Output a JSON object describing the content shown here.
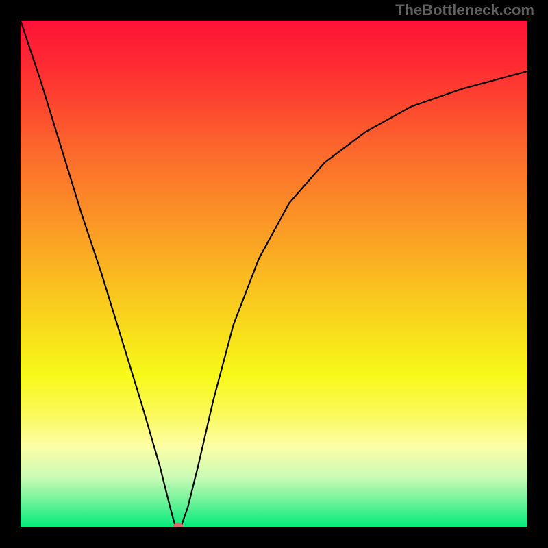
{
  "watermark": "TheBottleneck.com",
  "chart_data": {
    "type": "line",
    "title": "",
    "xlabel": "",
    "ylabel": "",
    "xlim": [
      0,
      1
    ],
    "ylim": [
      0,
      1
    ],
    "legend": null,
    "background_gradient": {
      "stops": [
        {
          "offset": 0.0,
          "color": "#fe1237"
        },
        {
          "offset": 0.1,
          "color": "#fe2f32"
        },
        {
          "offset": 0.25,
          "color": "#fc662c"
        },
        {
          "offset": 0.4,
          "color": "#fb9726"
        },
        {
          "offset": 0.55,
          "color": "#f9c91e"
        },
        {
          "offset": 0.7,
          "color": "#f7f918"
        },
        {
          "offset": 0.78,
          "color": "#faf95e"
        },
        {
          "offset": 0.84,
          "color": "#fdfea6"
        },
        {
          "offset": 0.9,
          "color": "#cbfbb6"
        },
        {
          "offset": 0.94,
          "color": "#80f49e"
        },
        {
          "offset": 1.0,
          "color": "#00ec7b"
        }
      ]
    },
    "series": [
      {
        "name": "curve",
        "color": "#000000",
        "stroke_width": 2.2,
        "x": [
          0.0,
          0.04,
          0.08,
          0.12,
          0.16,
          0.2,
          0.24,
          0.275,
          0.295,
          0.305,
          0.317,
          0.33,
          0.35,
          0.38,
          0.42,
          0.47,
          0.53,
          0.6,
          0.68,
          0.77,
          0.87,
          1.0
        ],
        "y": [
          1.0,
          0.88,
          0.75,
          0.62,
          0.5,
          0.37,
          0.24,
          0.12,
          0.04,
          0.003,
          0.003,
          0.04,
          0.12,
          0.25,
          0.4,
          0.53,
          0.64,
          0.72,
          0.78,
          0.83,
          0.865,
          0.9
        ]
      }
    ],
    "marker": {
      "x": 0.311,
      "y": 0.003,
      "rx": 7,
      "ry": 5,
      "color": "#d76a6a"
    }
  }
}
